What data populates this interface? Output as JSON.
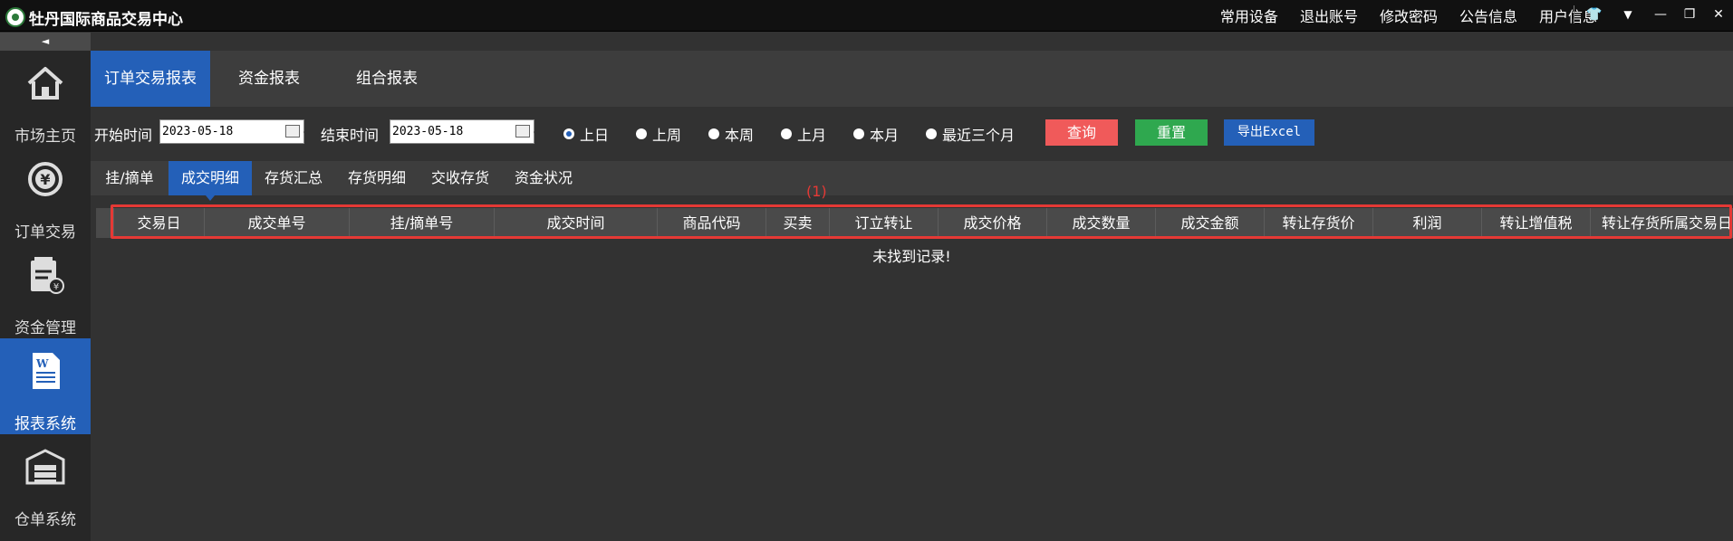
{
  "app": {
    "title": "牡丹国际商品交易中心"
  },
  "top_menu": [
    "常用设备",
    "退出账号",
    "修改密码",
    "公告信息",
    "用户信息"
  ],
  "window_controls": {
    "theme": "👕",
    "menu": "▼",
    "minimize": "—",
    "restore": "❐",
    "close": "✕"
  },
  "sidebar": {
    "collapse": "◄",
    "items": [
      {
        "label": "市场主页",
        "icon": "home-icon",
        "active": false
      },
      {
        "label": "订单交易",
        "icon": "yen-exchange-icon",
        "active": false
      },
      {
        "label": "资金管理",
        "icon": "clipboard-yen-icon",
        "active": false
      },
      {
        "label": "报表系统",
        "icon": "word-document-icon",
        "active": true
      },
      {
        "label": "仓单系统",
        "icon": "warehouse-icon",
        "active": false
      }
    ]
  },
  "main_tabs": [
    {
      "label": "订单交易报表",
      "active": true
    },
    {
      "label": "资金报表",
      "active": false
    },
    {
      "label": "组合报表",
      "active": false
    }
  ],
  "filters": {
    "start_label": "开始时间",
    "start_value": "2023-05-18",
    "end_label": "结束时间",
    "end_value": "2023-05-18",
    "ranges": [
      {
        "label": "上日",
        "checked": true
      },
      {
        "label": "上周",
        "checked": false
      },
      {
        "label": "本周",
        "checked": false
      },
      {
        "label": "上月",
        "checked": false
      },
      {
        "label": "本月",
        "checked": false
      },
      {
        "label": "最近三个月",
        "checked": false
      }
    ],
    "query_label": "查询",
    "reset_label": "重置",
    "export_label": "导出Excel"
  },
  "colors": {
    "query": "#f05a5a",
    "reset": "#2fa84f",
    "export": "#2460b8",
    "active": "#2460b8",
    "annotation": "#e53935"
  },
  "sub_tabs": [
    {
      "label": "挂/摘单",
      "active": false
    },
    {
      "label": "成交明细",
      "active": true
    },
    {
      "label": "存货汇总",
      "active": false
    },
    {
      "label": "存货明细",
      "active": false
    },
    {
      "label": "交收存货",
      "active": false
    },
    {
      "label": "资金状况",
      "active": false
    }
  ],
  "annotation": "(1)",
  "table": {
    "columns": [
      "交易日",
      "成交单号",
      "挂/摘单号",
      "成交时间",
      "商品代码",
      "买卖",
      "订立转让",
      "成交价格",
      "成交数量",
      "成交金额",
      "转让存货价",
      "利润",
      "转让增值税",
      "转让存货所属交易日"
    ],
    "empty_text": "未找到记录!"
  }
}
